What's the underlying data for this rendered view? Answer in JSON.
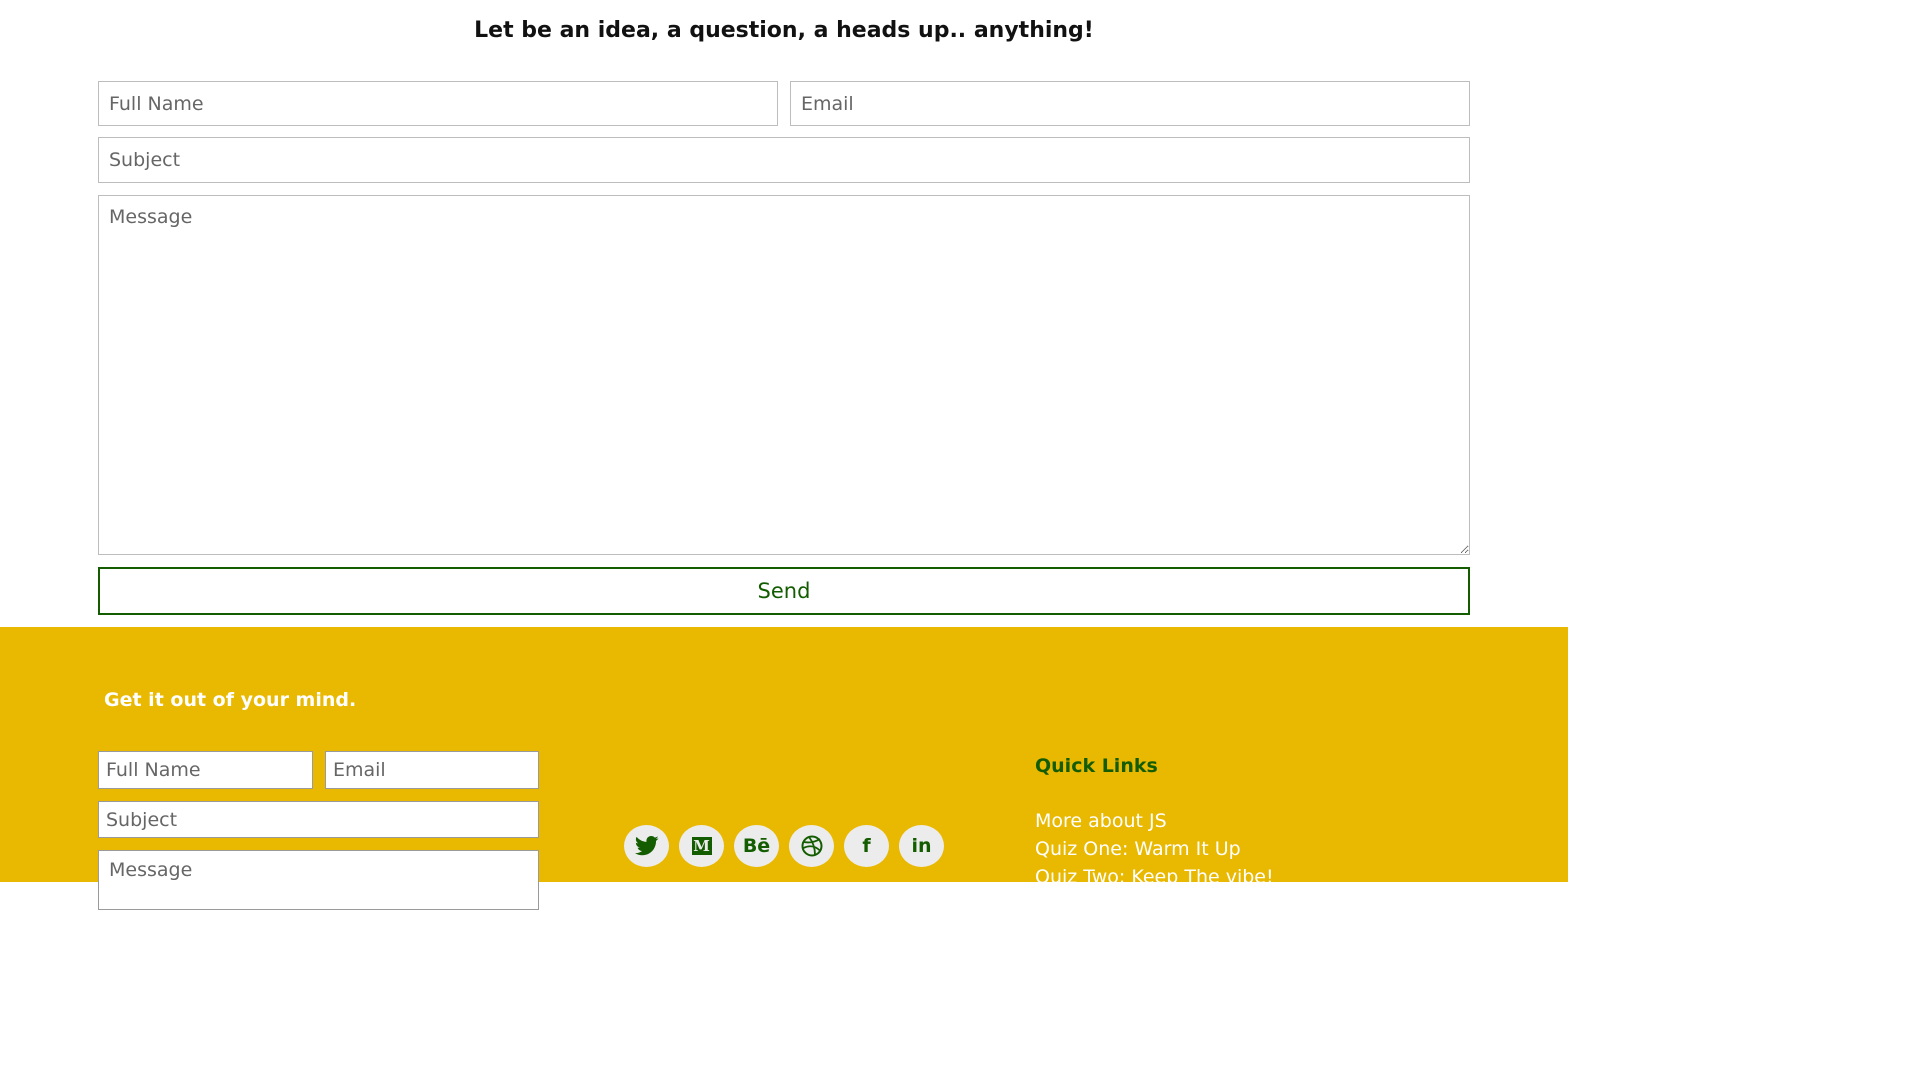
{
  "contact": {
    "heading": "Let be an idea, a question, a heads up.. anything!",
    "full_name_placeholder": "Full Name",
    "email_placeholder": "Email",
    "subject_placeholder": "Subject",
    "message_placeholder": "Message",
    "send_label": "Send"
  },
  "footer": {
    "tagline": "Get it out of your mind.",
    "form": {
      "full_name_placeholder": "Full Name",
      "email_placeholder": "Email",
      "subject_placeholder": "Subject",
      "message_placeholder": "Message"
    },
    "social": [
      {
        "icon": "twitter-icon"
      },
      {
        "icon": "medium-icon",
        "glyph": "M"
      },
      {
        "icon": "behance-icon",
        "glyph": "Bē"
      },
      {
        "icon": "dribbble-icon"
      },
      {
        "icon": "facebook-icon",
        "glyph": "f"
      },
      {
        "icon": "linkedin-icon",
        "glyph": "in"
      }
    ],
    "quick_links_title": "Quick Links",
    "quick_links": [
      "More about JS",
      "Quiz One: Warm It Up",
      "Quiz Two: Keep The vibe!"
    ]
  },
  "colors": {
    "accent_green": "#135c00",
    "footer_yellow": "#e9b800"
  }
}
